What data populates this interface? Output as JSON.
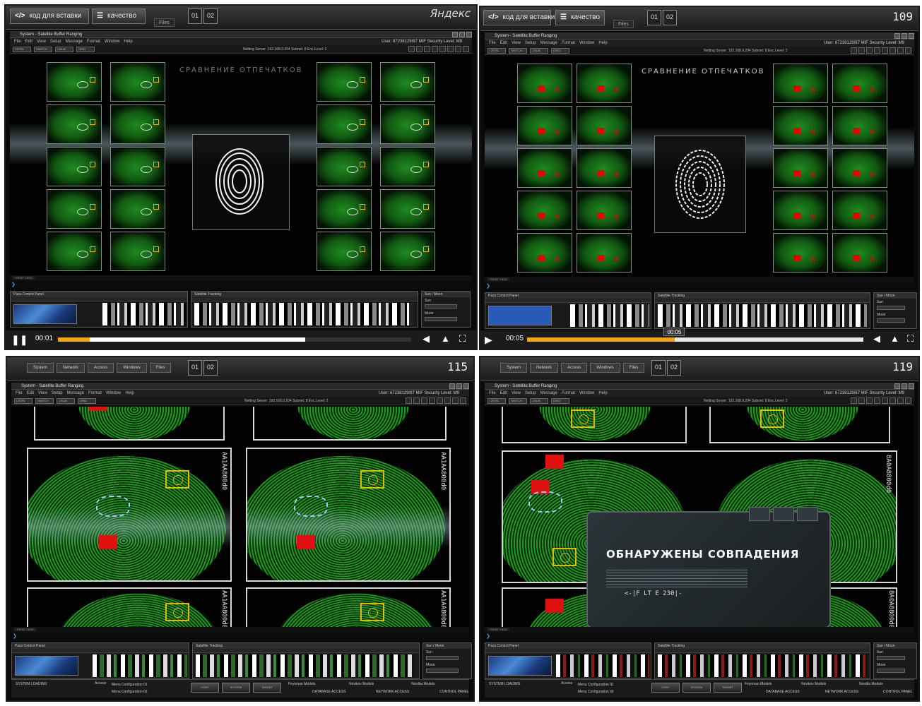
{
  "player_bar": {
    "embed_label": "код для вставки",
    "quality_label": "качество",
    "brand": "Яндекс",
    "frame1_time": "00:01",
    "frame2_time": "00:05",
    "frame2_tooltip": "00:05",
    "frame1_progress": 0.09,
    "frame2_progress": 0.44
  },
  "taskbar": {
    "files_label": "Files",
    "num1": "01",
    "num2": "02",
    "frame2_counter": "109",
    "frame3_counter": "115",
    "frame4_counter": "119",
    "tabs": [
      "System",
      "Network",
      "Access",
      "Windows",
      "Files"
    ]
  },
  "window": {
    "title": "System - Satellite Buffer Ranging",
    "menus": [
      "File",
      "Edit",
      "View",
      "Setup",
      "Message",
      "Format",
      "Window",
      "Help"
    ],
    "user": "User: 67238129/87 MIF    Security Level: M9",
    "dropdowns": [
      "CRTRL",
      "SWITCH",
      "CRLIB",
      "GRID"
    ],
    "netting": "Netting   Server: 192.168.0.204   Subnet: 8   Enc.Level: 2"
  },
  "compare": {
    "title": "СРАВНЕНИЕ ОТПЕЧАТКОВ"
  },
  "panels": {
    "pass_control": "Pass Control Panel",
    "setup": "SETUP",
    "sat_tracking": "Satellite Tracking",
    "sun_moon": "Sun / Moon",
    "sun": "Sun",
    "moon": "Moon",
    "print_view": "PRINT VIEW"
  },
  "detail": {
    "code_top": "AA1AA800d0",
    "code_alt": "8A0A8800d0",
    "dialog_title": "ОБНАРУЖЕНЫ СОВПАДЕНИЯ",
    "dialog_code": "<-|F LT E 230|-"
  },
  "status_bar": {
    "system_loading": "SYSTEM LOADING",
    "access": "Access",
    "menu1": "Menu Configuration 01",
    "menu2": "Menu Configuration 02",
    "btn_cont": "CONT",
    "btn_system": "SYSTEM",
    "btn_target": "TARGET",
    "models1": "Feynman Models",
    "models2": "Novikov Models",
    "models3": "Nordita Models",
    "db_access": "DATABASE ACCESS",
    "net_access": "NETWORK ACCESS",
    "ctrl_panel": "CONTROL PANEL"
  },
  "colors": {
    "progress": "#f3a70d",
    "fingerprint_green": "#1f9a1f",
    "alert_red": "#e01010",
    "target_yellow": "#e6b800"
  }
}
